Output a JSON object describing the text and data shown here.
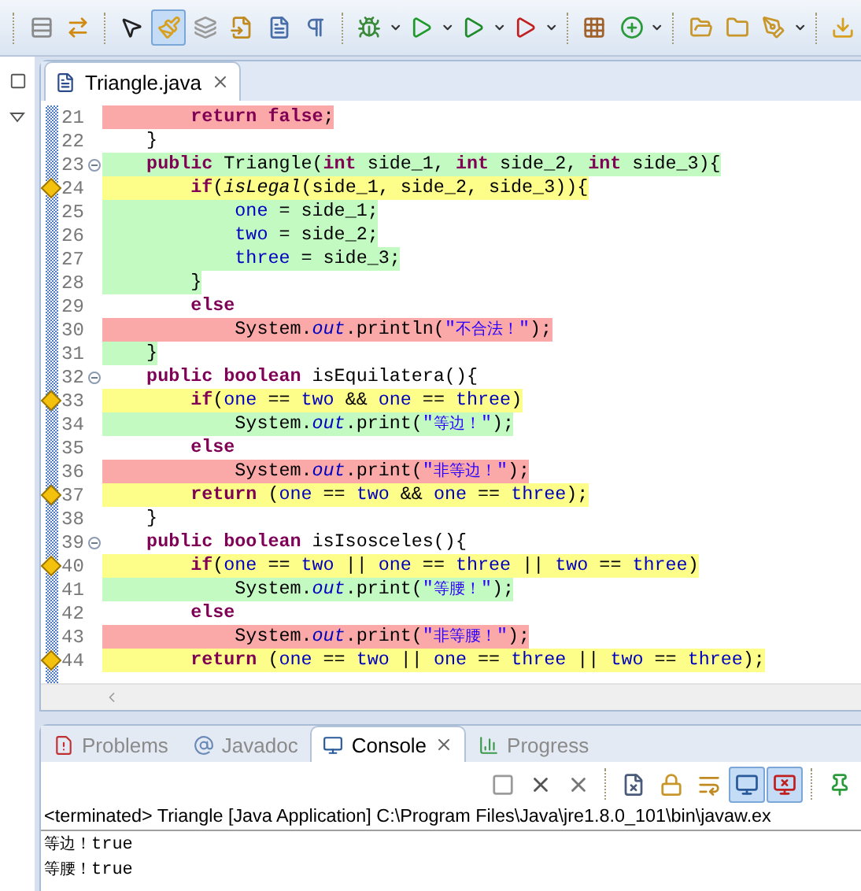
{
  "toolbar": [
    {
      "kind": "separator"
    },
    {
      "kind": "list",
      "selected": false,
      "menu": false
    },
    {
      "kind": "swap",
      "selected": false,
      "menu": false
    },
    {
      "kind": "separator"
    },
    {
      "kind": "cursor",
      "selected": false,
      "menu": false
    },
    {
      "kind": "brush",
      "selected": true,
      "menu": false
    },
    {
      "kind": "layers",
      "selected": false,
      "menu": false
    },
    {
      "kind": "doc-arrow",
      "selected": false,
      "menu": false
    },
    {
      "kind": "doc-list",
      "selected": false,
      "menu": false
    },
    {
      "kind": "paragraph",
      "selected": false,
      "menu": false
    },
    {
      "kind": "separator"
    },
    {
      "kind": "bug",
      "selected": false,
      "menu": true
    },
    {
      "kind": "play",
      "selected": false,
      "menu": true
    },
    {
      "kind": "play-coverage",
      "selected": false,
      "menu": true
    },
    {
      "kind": "play-tool",
      "selected": false,
      "menu": true
    },
    {
      "kind": "separator"
    },
    {
      "kind": "grid",
      "selected": false,
      "menu": false
    },
    {
      "kind": "new-class",
      "selected": false,
      "menu": true
    },
    {
      "kind": "separator"
    },
    {
      "kind": "folder-open",
      "selected": false,
      "menu": false
    },
    {
      "kind": "folder",
      "selected": false,
      "menu": false
    },
    {
      "kind": "pen",
      "selected": false,
      "menu": true
    },
    {
      "kind": "separator"
    },
    {
      "kind": "download",
      "selected": false,
      "menu": false
    }
  ],
  "editor": {
    "tab": {
      "label": "Triangle.java",
      "selected": true
    },
    "lines": [
      {
        "number": "21",
        "color": "#fba8a8",
        "marker": false,
        "fold": false,
        "tokens": [
          {
            "kind": "keyword",
            "text": "        return"
          },
          {
            "kind": "keyword",
            "text": " false"
          },
          {
            "kind": "plain",
            "text": ";"
          }
        ]
      },
      {
        "number": "22",
        "marker": false,
        "fold": false,
        "tokens": [
          {
            "kind": "plain",
            "text": "    }"
          }
        ]
      },
      {
        "number": "23",
        "color": "#c2fac2",
        "marker": false,
        "fold": true,
        "tokens": [
          {
            "kind": "keyword",
            "text": "    public"
          },
          {
            "kind": "plain",
            "text": " Triangle("
          },
          {
            "kind": "keyword",
            "text": "int"
          },
          {
            "kind": "plain",
            "text": " side_1, "
          },
          {
            "kind": "keyword",
            "text": "int"
          },
          {
            "kind": "plain",
            "text": " side_2, "
          },
          {
            "kind": "keyword",
            "text": "int"
          },
          {
            "kind": "plain",
            "text": " side_3){"
          }
        ]
      },
      {
        "number": "24",
        "color": "#fdfd8a",
        "marker": true,
        "fold": false,
        "tokens": [
          {
            "kind": "keyword",
            "text": "        if"
          },
          {
            "kind": "plain",
            "text": "("
          },
          {
            "kind": "method",
            "text": "isLegal"
          },
          {
            "kind": "plain",
            "text": "(side_1, side_2, side_3)){"
          }
        ]
      },
      {
        "number": "25",
        "color": "#c2fac2",
        "marker": false,
        "fold": false,
        "tokens": [
          {
            "kind": "field",
            "text": "            one"
          },
          {
            "kind": "plain",
            "text": " = side_1;"
          }
        ]
      },
      {
        "number": "26",
        "color": "#c2fac2",
        "marker": false,
        "fold": false,
        "tokens": [
          {
            "kind": "field",
            "text": "            two"
          },
          {
            "kind": "plain",
            "text": " = side_2;"
          }
        ]
      },
      {
        "number": "27",
        "color": "#c2fac2",
        "marker": false,
        "fold": false,
        "tokens": [
          {
            "kind": "field",
            "text": "            three"
          },
          {
            "kind": "plain",
            "text": " = side_3;"
          }
        ]
      },
      {
        "number": "28",
        "color": "#c2fac2",
        "marker": false,
        "fold": false,
        "tokens": [
          {
            "kind": "plain",
            "text": "        }"
          }
        ]
      },
      {
        "number": "29",
        "marker": false,
        "fold": false,
        "tokens": [
          {
            "kind": "keyword",
            "text": "        else"
          }
        ]
      },
      {
        "number": "30",
        "color": "#fba8a8",
        "marker": false,
        "fold": false,
        "tokens": [
          {
            "kind": "plain",
            "text": "            System."
          },
          {
            "kind": "static",
            "text": "out"
          },
          {
            "kind": "plain",
            "text": ".println("
          },
          {
            "kind": "string",
            "text": "\""
          },
          {
            "kind": "cjk",
            "text": "不合法！"
          },
          {
            "kind": "string",
            "text": "\""
          },
          {
            "kind": "plain",
            "text": ");"
          }
        ]
      },
      {
        "number": "31",
        "color": "#c2fac2",
        "marker": false,
        "fold": false,
        "tokens": [
          {
            "kind": "plain",
            "text": "    }"
          }
        ]
      },
      {
        "number": "32",
        "marker": false,
        "fold": true,
        "tokens": [
          {
            "kind": "keyword",
            "text": "    public"
          },
          {
            "kind": "keyword",
            "text": " boolean"
          },
          {
            "kind": "plain",
            "text": " isEquilatera(){"
          }
        ]
      },
      {
        "number": "33",
        "color": "#fdfd8a",
        "marker": true,
        "fold": false,
        "tokens": [
          {
            "kind": "keyword",
            "text": "        if"
          },
          {
            "kind": "plain",
            "text": "("
          },
          {
            "kind": "field",
            "text": "one"
          },
          {
            "kind": "plain",
            "text": " == "
          },
          {
            "kind": "field",
            "text": "two"
          },
          {
            "kind": "plain",
            "text": " && "
          },
          {
            "kind": "field",
            "text": "one"
          },
          {
            "kind": "plain",
            "text": " == "
          },
          {
            "kind": "field",
            "text": "three"
          },
          {
            "kind": "plain",
            "text": ")"
          }
        ]
      },
      {
        "number": "34",
        "color": "#c2fac2",
        "marker": false,
        "fold": false,
        "tokens": [
          {
            "kind": "plain",
            "text": "            System."
          },
          {
            "kind": "static",
            "text": "out"
          },
          {
            "kind": "plain",
            "text": ".print("
          },
          {
            "kind": "string",
            "text": "\""
          },
          {
            "kind": "cjk",
            "text": "等边！"
          },
          {
            "kind": "string",
            "text": "\""
          },
          {
            "kind": "plain",
            "text": ");"
          }
        ]
      },
      {
        "number": "35",
        "marker": false,
        "fold": false,
        "tokens": [
          {
            "kind": "keyword",
            "text": "        else"
          }
        ]
      },
      {
        "number": "36",
        "color": "#fba8a8",
        "marker": false,
        "fold": false,
        "tokens": [
          {
            "kind": "plain",
            "text": "            System."
          },
          {
            "kind": "static",
            "text": "out"
          },
          {
            "kind": "plain",
            "text": ".print("
          },
          {
            "kind": "string",
            "text": "\""
          },
          {
            "kind": "cjk",
            "text": "非等边！"
          },
          {
            "kind": "string",
            "text": "\""
          },
          {
            "kind": "plain",
            "text": ");"
          }
        ]
      },
      {
        "number": "37",
        "color": "#fdfd8a",
        "marker": true,
        "fold": false,
        "tokens": [
          {
            "kind": "keyword",
            "text": "        return"
          },
          {
            "kind": "plain",
            "text": " ("
          },
          {
            "kind": "field",
            "text": "one"
          },
          {
            "kind": "plain",
            "text": " == "
          },
          {
            "kind": "field",
            "text": "two"
          },
          {
            "kind": "plain",
            "text": " && "
          },
          {
            "kind": "field",
            "text": "one"
          },
          {
            "kind": "plain",
            "text": " == "
          },
          {
            "kind": "field",
            "text": "three"
          },
          {
            "kind": "plain",
            "text": ");"
          }
        ]
      },
      {
        "number": "38",
        "marker": false,
        "fold": false,
        "tokens": [
          {
            "kind": "plain",
            "text": "    }"
          }
        ]
      },
      {
        "number": "39",
        "marker": false,
        "fold": true,
        "tokens": [
          {
            "kind": "keyword",
            "text": "    public"
          },
          {
            "kind": "keyword",
            "text": " boolean"
          },
          {
            "kind": "plain",
            "text": " isIsosceles(){"
          }
        ]
      },
      {
        "number": "40",
        "color": "#fdfd8a",
        "marker": true,
        "fold": false,
        "tokens": [
          {
            "kind": "keyword",
            "text": "        if"
          },
          {
            "kind": "plain",
            "text": "("
          },
          {
            "kind": "field",
            "text": "one"
          },
          {
            "kind": "plain",
            "text": " == "
          },
          {
            "kind": "field",
            "text": "two"
          },
          {
            "kind": "plain",
            "text": " || "
          },
          {
            "kind": "field",
            "text": "one"
          },
          {
            "kind": "plain",
            "text": " == "
          },
          {
            "kind": "field",
            "text": "three"
          },
          {
            "kind": "plain",
            "text": " || "
          },
          {
            "kind": "field",
            "text": "two"
          },
          {
            "kind": "plain",
            "text": " == "
          },
          {
            "kind": "field",
            "text": "three"
          },
          {
            "kind": "plain",
            "text": ")"
          }
        ]
      },
      {
        "number": "41",
        "color": "#c2fac2",
        "marker": false,
        "fold": false,
        "tokens": [
          {
            "kind": "plain",
            "text": "            System."
          },
          {
            "kind": "static",
            "text": "out"
          },
          {
            "kind": "plain",
            "text": ".print("
          },
          {
            "kind": "string",
            "text": "\""
          },
          {
            "kind": "cjk",
            "text": "等腰！"
          },
          {
            "kind": "string",
            "text": "\""
          },
          {
            "kind": "plain",
            "text": ");"
          }
        ]
      },
      {
        "number": "42",
        "marker": false,
        "fold": false,
        "tokens": [
          {
            "kind": "keyword",
            "text": "        else"
          }
        ]
      },
      {
        "number": "43",
        "color": "#fba8a8",
        "marker": false,
        "fold": false,
        "tokens": [
          {
            "kind": "plain",
            "text": "            System."
          },
          {
            "kind": "static",
            "text": "out"
          },
          {
            "kind": "plain",
            "text": ".print("
          },
          {
            "kind": "string",
            "text": "\""
          },
          {
            "kind": "cjk",
            "text": "非等腰！"
          },
          {
            "kind": "string",
            "text": "\""
          },
          {
            "kind": "plain",
            "text": ");"
          }
        ]
      },
      {
        "number": "44",
        "color": "#fdfd8a",
        "marker": true,
        "fold": false,
        "tokens": [
          {
            "kind": "keyword",
            "text": "        return"
          },
          {
            "kind": "plain",
            "text": " ("
          },
          {
            "kind": "field",
            "text": "one"
          },
          {
            "kind": "plain",
            "text": " == "
          },
          {
            "kind": "field",
            "text": "two"
          },
          {
            "kind": "plain",
            "text": " || "
          },
          {
            "kind": "field",
            "text": "one"
          },
          {
            "kind": "plain",
            "text": " == "
          },
          {
            "kind": "field",
            "text": "three"
          },
          {
            "kind": "plain",
            "text": " || "
          },
          {
            "kind": "field",
            "text": "two"
          },
          {
            "kind": "plain",
            "text": " == "
          },
          {
            "kind": "field",
            "text": "three"
          },
          {
            "kind": "plain",
            "text": ");"
          }
        ]
      }
    ]
  },
  "bottom_panel": {
    "tabs": [
      {
        "label": "Problems",
        "kind": "problems",
        "selected": false
      },
      {
        "label": "Javadoc",
        "kind": "javadoc",
        "selected": false
      },
      {
        "label": "Console",
        "kind": "console",
        "selected": true
      },
      {
        "label": "Progress",
        "kind": "progress",
        "selected": false
      }
    ],
    "toolbar": [
      {
        "kind": "stop",
        "selected": false
      },
      {
        "kind": "remove",
        "selected": false
      },
      {
        "kind": "remove-all",
        "selected": false
      },
      {
        "kind": "separator"
      },
      {
        "kind": "clear",
        "selected": false
      },
      {
        "kind": "scroll-lock",
        "selected": false
      },
      {
        "kind": "word-wrap",
        "selected": false
      },
      {
        "kind": "show-stdout",
        "selected": true
      },
      {
        "kind": "show-stderr",
        "selected": true
      },
      {
        "kind": "separator"
      },
      {
        "kind": "pin",
        "selected": false
      }
    ],
    "console": {
      "header": "<terminated> Triangle [Java Application] C:\\Program Files\\Java\\jre1.8.0_101\\bin\\javaw.ex",
      "output": [
        {
          "label": "等边！",
          "value": "true"
        },
        {
          "label": "等腰！",
          "value": "true"
        }
      ]
    }
  }
}
